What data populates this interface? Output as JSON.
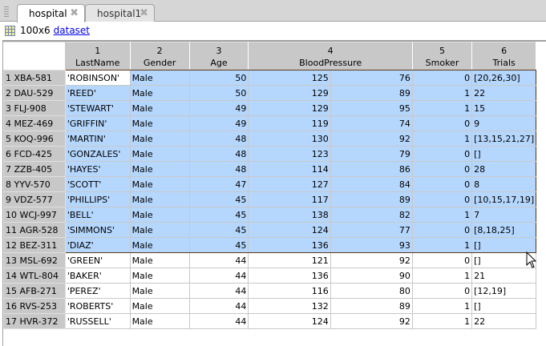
{
  "tabs": [
    {
      "label": "hospital",
      "active": true
    },
    {
      "label": "hospital1",
      "active": false
    }
  ],
  "info": {
    "size": "100x6",
    "type_link": "dataset"
  },
  "columns": [
    {
      "index": "1",
      "name": "LastName"
    },
    {
      "index": "2",
      "name": "Gender"
    },
    {
      "index": "3",
      "name": "Age"
    },
    {
      "index": "4",
      "name": "BloodPressure"
    },
    {
      "index": "5",
      "name": "Smoker"
    },
    {
      "index": "6",
      "name": "Trials"
    }
  ],
  "selected_rows": 12,
  "rows": [
    {
      "label": "1 XBA-581",
      "lastname": "'ROBINSON'",
      "gender": "Male",
      "age": "50",
      "bp1": "125",
      "bp2": "76",
      "smoker": "0",
      "trials": "[20,26,30]"
    },
    {
      "label": "2 DAU-529",
      "lastname": "'REED'",
      "gender": "Male",
      "age": "50",
      "bp1": "129",
      "bp2": "89",
      "smoker": "1",
      "trials": "22"
    },
    {
      "label": "3 FLJ-908",
      "lastname": "'STEWART'",
      "gender": "Male",
      "age": "49",
      "bp1": "129",
      "bp2": "95",
      "smoker": "1",
      "trials": "15"
    },
    {
      "label": "4 MEZ-469",
      "lastname": "'GRIFFIN'",
      "gender": "Male",
      "age": "49",
      "bp1": "119",
      "bp2": "74",
      "smoker": "0",
      "trials": "9"
    },
    {
      "label": "5 KOQ-996",
      "lastname": "'MARTIN'",
      "gender": "Male",
      "age": "48",
      "bp1": "130",
      "bp2": "92",
      "smoker": "1",
      "trials": "[13,15,21,27]"
    },
    {
      "label": "6 FCD-425",
      "lastname": "'GONZALES'",
      "gender": "Male",
      "age": "48",
      "bp1": "123",
      "bp2": "79",
      "smoker": "0",
      "trials": "[]"
    },
    {
      "label": "7 ZZB-405",
      "lastname": "'HAYES'",
      "gender": "Male",
      "age": "48",
      "bp1": "114",
      "bp2": "86",
      "smoker": "0",
      "trials": "28"
    },
    {
      "label": "8 YYV-570",
      "lastname": "'SCOTT'",
      "gender": "Male",
      "age": "47",
      "bp1": "127",
      "bp2": "84",
      "smoker": "0",
      "trials": "8"
    },
    {
      "label": "9 VDZ-577",
      "lastname": "'PHILLIPS'",
      "gender": "Male",
      "age": "45",
      "bp1": "117",
      "bp2": "89",
      "smoker": "0",
      "trials": "[10,15,17,19]"
    },
    {
      "label": "10 WCJ-997",
      "lastname": "'BELL'",
      "gender": "Male",
      "age": "45",
      "bp1": "138",
      "bp2": "82",
      "smoker": "1",
      "trials": "7"
    },
    {
      "label": "11 AGR-528",
      "lastname": "'SIMMONS'",
      "gender": "Male",
      "age": "45",
      "bp1": "124",
      "bp2": "77",
      "smoker": "0",
      "trials": "[8,18,25]"
    },
    {
      "label": "12 BEZ-311",
      "lastname": "'DIAZ'",
      "gender": "Male",
      "age": "45",
      "bp1": "136",
      "bp2": "93",
      "smoker": "1",
      "trials": "[]"
    },
    {
      "label": "13 MSL-692",
      "lastname": "'GREEN'",
      "gender": "Male",
      "age": "44",
      "bp1": "121",
      "bp2": "92",
      "smoker": "0",
      "trials": "[]"
    },
    {
      "label": "14 WTL-804",
      "lastname": "'BAKER'",
      "gender": "Male",
      "age": "44",
      "bp1": "136",
      "bp2": "90",
      "smoker": "1",
      "trials": "21"
    },
    {
      "label": "15 AFB-271",
      "lastname": "'PEREZ'",
      "gender": "Male",
      "age": "44",
      "bp1": "116",
      "bp2": "80",
      "smoker": "0",
      "trials": "[12,19]"
    },
    {
      "label": "16 RVS-253",
      "lastname": "'ROBERTS'",
      "gender": "Male",
      "age": "44",
      "bp1": "132",
      "bp2": "89",
      "smoker": "1",
      "trials": "[]"
    },
    {
      "label": "17 HVR-372",
      "lastname": "'RUSSELL'",
      "gender": "Male",
      "age": "44",
      "bp1": "124",
      "bp2": "92",
      "smoker": "1",
      "trials": "22"
    }
  ]
}
